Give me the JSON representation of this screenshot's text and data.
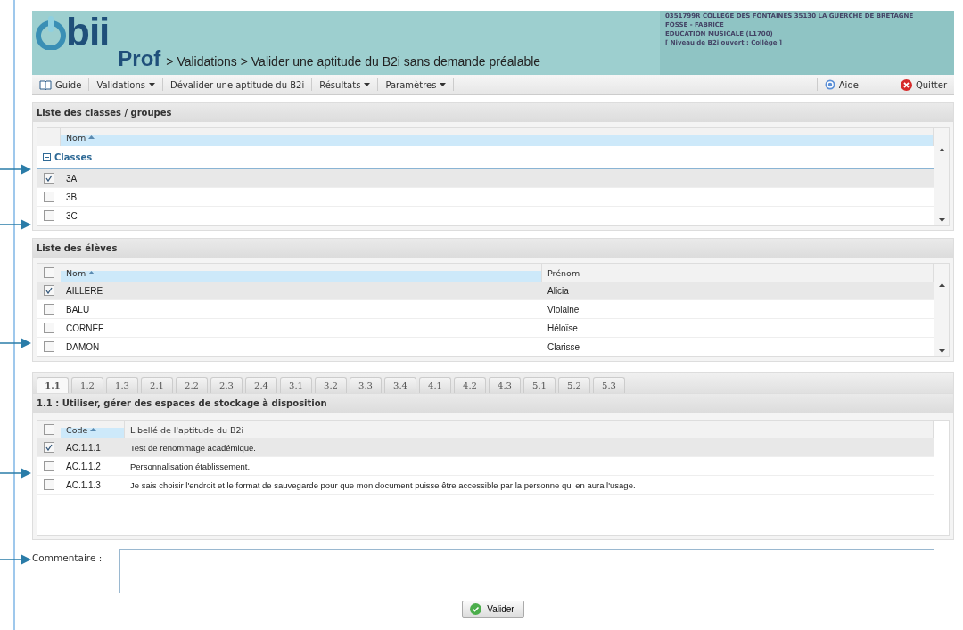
{
  "header": {
    "logo": "bii",
    "role": "Prof",
    "breadcrumb": "> Validations > Valider une aptitude du B2i sans demande préalable",
    "info": [
      "0351799R COLLEGE DES FONTAINES 35130 LA GUERCHE DE BRETAGNE",
      "FOSSE - FABRICE",
      "EDUCATION MUSICALE (L1700)",
      "[ Niveau de B2i ouvert : Collège ]"
    ]
  },
  "menu": [
    {
      "label": "Guide",
      "kind": "book",
      "dropdown": false
    },
    {
      "label": "Validations",
      "kind": "plain",
      "dropdown": true
    },
    {
      "label": "Dévalider une aptitude du B2i",
      "kind": "plain",
      "dropdown": false
    },
    {
      "label": "Résultats",
      "kind": "plain",
      "dropdown": true
    },
    {
      "label": "Paramètres",
      "kind": "plain",
      "dropdown": true
    }
  ],
  "menu_right": [
    {
      "label": "Aide",
      "kind": "help"
    },
    {
      "label": "Quitter",
      "kind": "quit"
    }
  ],
  "classes": {
    "title": "Liste des classes / groupes",
    "column": "Nom",
    "group": {
      "label": "Classes",
      "expanded": true
    },
    "rows": [
      {
        "name": "3A",
        "checked": true
      },
      {
        "name": "3B",
        "checked": false
      },
      {
        "name": "3C",
        "checked": false
      }
    ]
  },
  "students": {
    "title": "Liste des élèves",
    "columns": [
      "Nom",
      "Prénom"
    ],
    "all_checked": false,
    "rows": [
      {
        "nom": "AILLERE",
        "prenom": "Alicia",
        "checked": true
      },
      {
        "nom": "BALU",
        "prenom": "Violaine",
        "checked": false
      },
      {
        "nom": "CORNÉE",
        "prenom": "Héloïse",
        "checked": false
      },
      {
        "nom": "DAMON",
        "prenom": "Clarisse",
        "checked": false
      }
    ]
  },
  "tabs": [
    {
      "label": "1.1",
      "selected": true
    },
    {
      "label": "1.2",
      "selected": false
    },
    {
      "label": "1.3",
      "selected": false
    },
    {
      "label": "2.1",
      "selected": false
    },
    {
      "label": "2.2",
      "selected": false
    },
    {
      "label": "2.3",
      "selected": false
    },
    {
      "label": "2.4",
      "selected": false
    },
    {
      "label": "3.1",
      "selected": false
    },
    {
      "label": "3.2",
      "selected": false
    },
    {
      "label": "3.3",
      "selected": false
    },
    {
      "label": "3.4",
      "selected": false
    },
    {
      "label": "4.1",
      "selected": false
    },
    {
      "label": "4.2",
      "selected": false
    },
    {
      "label": "4.3",
      "selected": false
    },
    {
      "label": "5.1",
      "selected": false
    },
    {
      "label": "5.2",
      "selected": false
    },
    {
      "label": "5.3",
      "selected": false
    }
  ],
  "aptitudes": {
    "title": "1.1 : Utiliser, gérer des espaces de stockage à disposition",
    "columns": [
      "Code",
      "Libellé de l'aptitude du B2i"
    ],
    "all_checked": false,
    "rows": [
      {
        "code": "AC.1.1.1",
        "label": "Test de renommage académique.",
        "checked": true
      },
      {
        "code": "AC.1.1.2",
        "label": "Personnalisation établissement.",
        "checked": false
      },
      {
        "code": "AC.1.1.3",
        "label": "Je sais choisir l'endroit et le format de sauvegarde pour que mon document puisse être accessible par la personne qui en aura l'usage.",
        "checked": false
      }
    ]
  },
  "comment": {
    "label": "Commentaire :"
  },
  "submit": "Valider"
}
